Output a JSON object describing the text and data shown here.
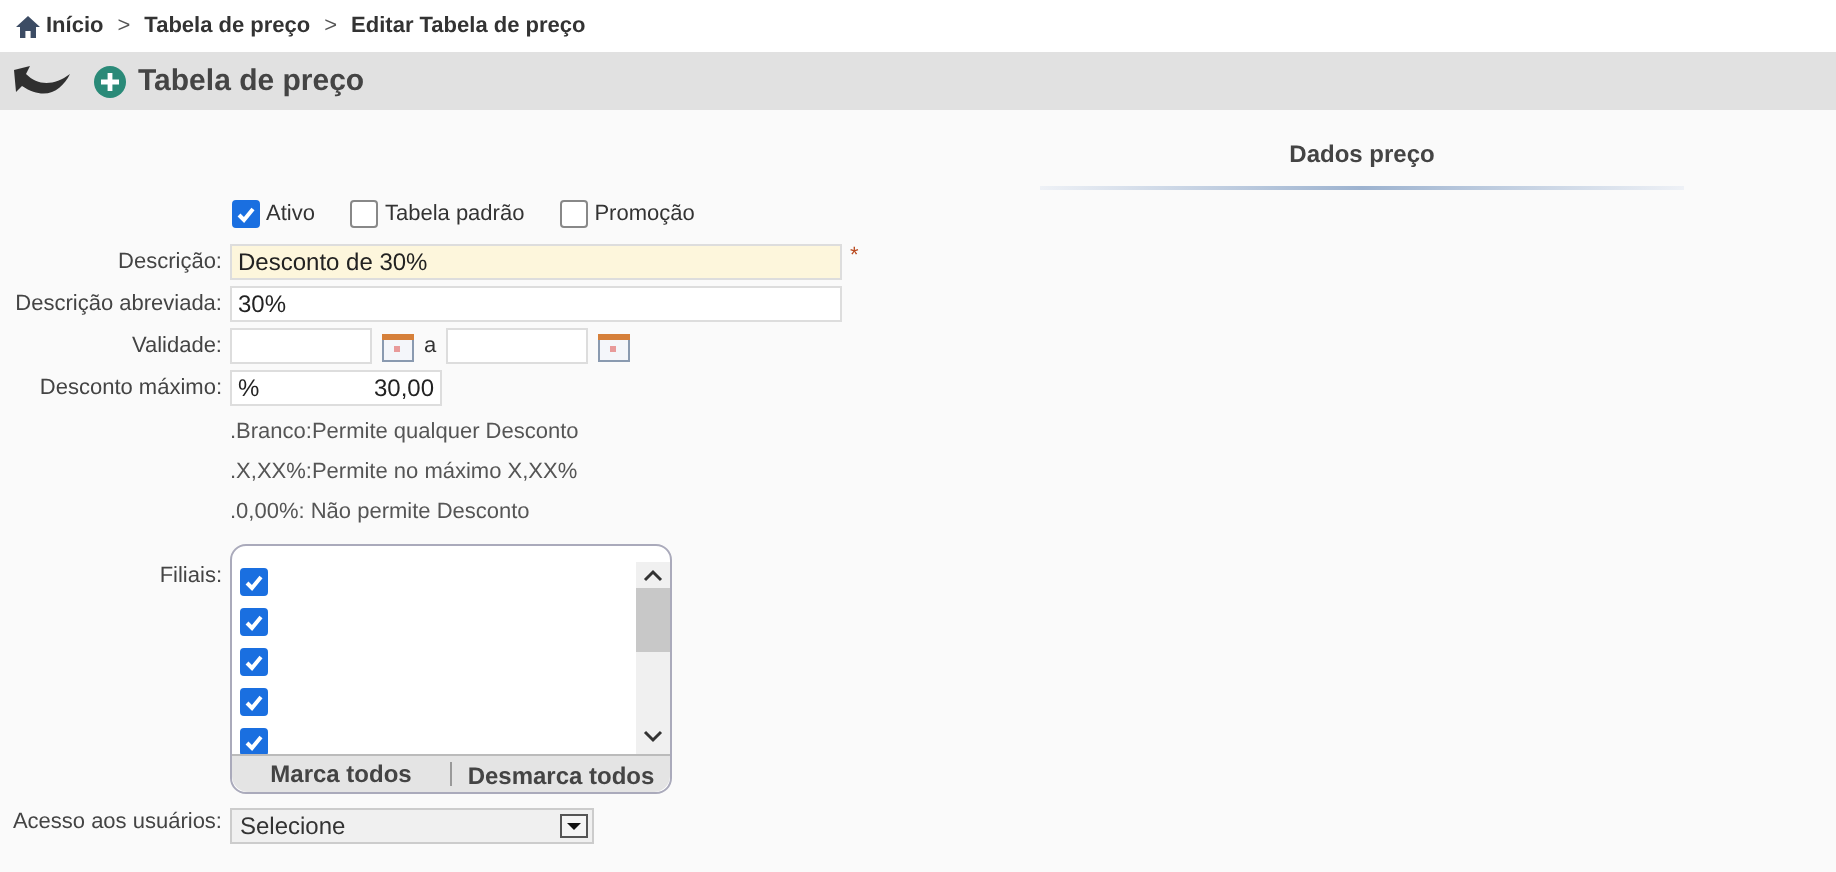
{
  "breadcrumb": [
    {
      "label": "Início",
      "kind": "home"
    },
    {
      "label": "Tabela de preço",
      "kind": "link"
    },
    {
      "label": "Editar Tabela de preço",
      "kind": "current"
    }
  ],
  "breadcrumb_separator": ">",
  "header": {
    "title": "Tabela de preço"
  },
  "options": [
    {
      "label": "Ativo",
      "checked": true
    },
    {
      "label": "Tabela padrão",
      "checked": false
    },
    {
      "label": "Promoção",
      "checked": false
    }
  ],
  "fields": [
    {
      "label": "Descrição:",
      "value": "Desconto de 30%",
      "focused": true,
      "required_mark": "*"
    },
    {
      "label": "Descrição abreviada:",
      "value": "30%",
      "focused": false
    }
  ],
  "validity": {
    "label": "Validade:",
    "separator": "a"
  },
  "max_discount": {
    "label": "Desconto máximo:",
    "prefix": "%",
    "value": "30,00"
  },
  "hints": [
    ".Branco:Permite qualquer Desconto",
    ".X,XX%:Permite no máximo X,XX%",
    ".0,00%: Não permite Desconto"
  ],
  "branches": {
    "label": "Filiais:",
    "items": [
      {
        "checked": true
      },
      {
        "checked": true
      },
      {
        "checked": true
      },
      {
        "checked": true
      },
      {
        "checked": true
      }
    ],
    "buttons": [
      "Marca todos",
      "Desmarca todos"
    ]
  },
  "user_access": {
    "label": "Acesso aos usuários:",
    "value": "Selecione"
  },
  "price_panel": {
    "title": "Dados preço"
  }
}
